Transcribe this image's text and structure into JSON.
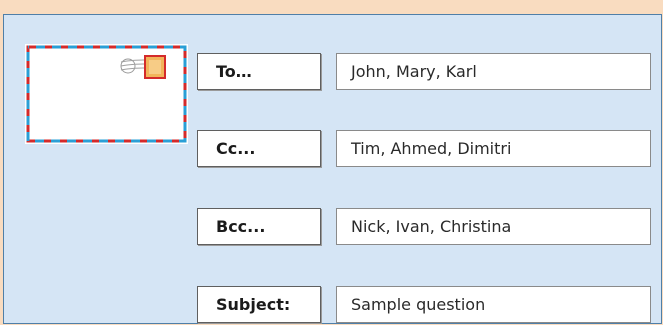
{
  "fields": [
    {
      "label": "To…",
      "value": "John, Mary, Karl"
    },
    {
      "label": "Cc...",
      "value": "Tim, Ahmed, Dimitri"
    },
    {
      "label": "Bcc...",
      "value": "Nick, Ivan, Christina"
    },
    {
      "label": "Subject:",
      "value": "Sample question"
    }
  ],
  "colors": {
    "background": "#f9dcc0",
    "panel": "#d5e5f5",
    "airmail_red": "#d42a2a",
    "airmail_blue": "#2a9fd6",
    "stamp": "#f2b45a"
  }
}
